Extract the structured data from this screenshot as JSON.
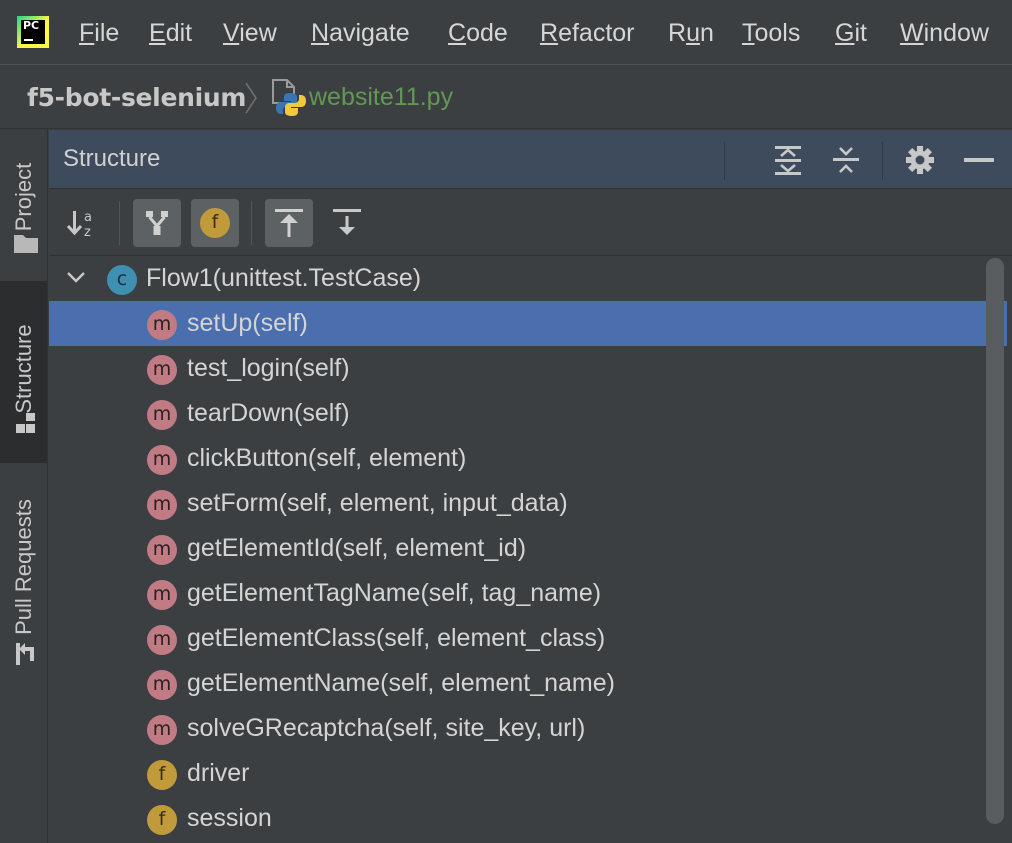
{
  "menubar": {
    "items": [
      {
        "pre": "",
        "mnemonic": "F",
        "post": "ile"
      },
      {
        "pre": "",
        "mnemonic": "E",
        "post": "dit"
      },
      {
        "pre": "",
        "mnemonic": "V",
        "post": "iew"
      },
      {
        "pre": "",
        "mnemonic": "N",
        "post": "avigate"
      },
      {
        "pre": "",
        "mnemonic": "C",
        "post": "ode"
      },
      {
        "pre": "",
        "mnemonic": "R",
        "post": "efactor"
      },
      {
        "pre": "R",
        "mnemonic": "u",
        "post": "n"
      },
      {
        "pre": "",
        "mnemonic": "T",
        "post": "ools"
      },
      {
        "pre": "",
        "mnemonic": "G",
        "post": "it"
      },
      {
        "pre": "",
        "mnemonic": "W",
        "post": "indow"
      }
    ],
    "logo_text": "PC"
  },
  "breadcrumb": {
    "project": "f5-bot-selenium",
    "file": "website11.py"
  },
  "sidebar": {
    "tabs": [
      {
        "label": "Project",
        "icon": "folder-icon",
        "active": false
      },
      {
        "label": "Structure",
        "icon": "structure-icon",
        "active": true
      },
      {
        "label": "Pull Requests",
        "icon": "pull-request-icon",
        "active": false
      }
    ]
  },
  "panel": {
    "title": "Structure"
  },
  "toolbar": {
    "field_badge": "f"
  },
  "tree": {
    "class": {
      "badge": "c",
      "label": "Flow1(unittest.TestCase)"
    },
    "members": [
      {
        "badge": "m",
        "label": "setUp(self)",
        "selected": true
      },
      {
        "badge": "m",
        "label": "test_login(self)"
      },
      {
        "badge": "m",
        "label": "tearDown(self)"
      },
      {
        "badge": "m",
        "label": "clickButton(self, element)"
      },
      {
        "badge": "m",
        "label": "setForm(self, element, input_data)"
      },
      {
        "badge": "m",
        "label": "getElementId(self, element_id)"
      },
      {
        "badge": "m",
        "label": "getElementTagName(self, tag_name)"
      },
      {
        "badge": "m",
        "label": "getElementClass(self, element_class)"
      },
      {
        "badge": "m",
        "label": "getElementName(self, element_name)"
      },
      {
        "badge": "m",
        "label": "solveGRecaptcha(self, site_key, url)"
      },
      {
        "badge": "f",
        "label": "driver"
      },
      {
        "badge": "f",
        "label": "session"
      }
    ]
  },
  "colors": {
    "selection": "#4b6eaf",
    "method_badge": "#c07b85",
    "field_badge": "#c19a3c",
    "class_badge": "#3e8fb0",
    "file_name": "#629755"
  }
}
